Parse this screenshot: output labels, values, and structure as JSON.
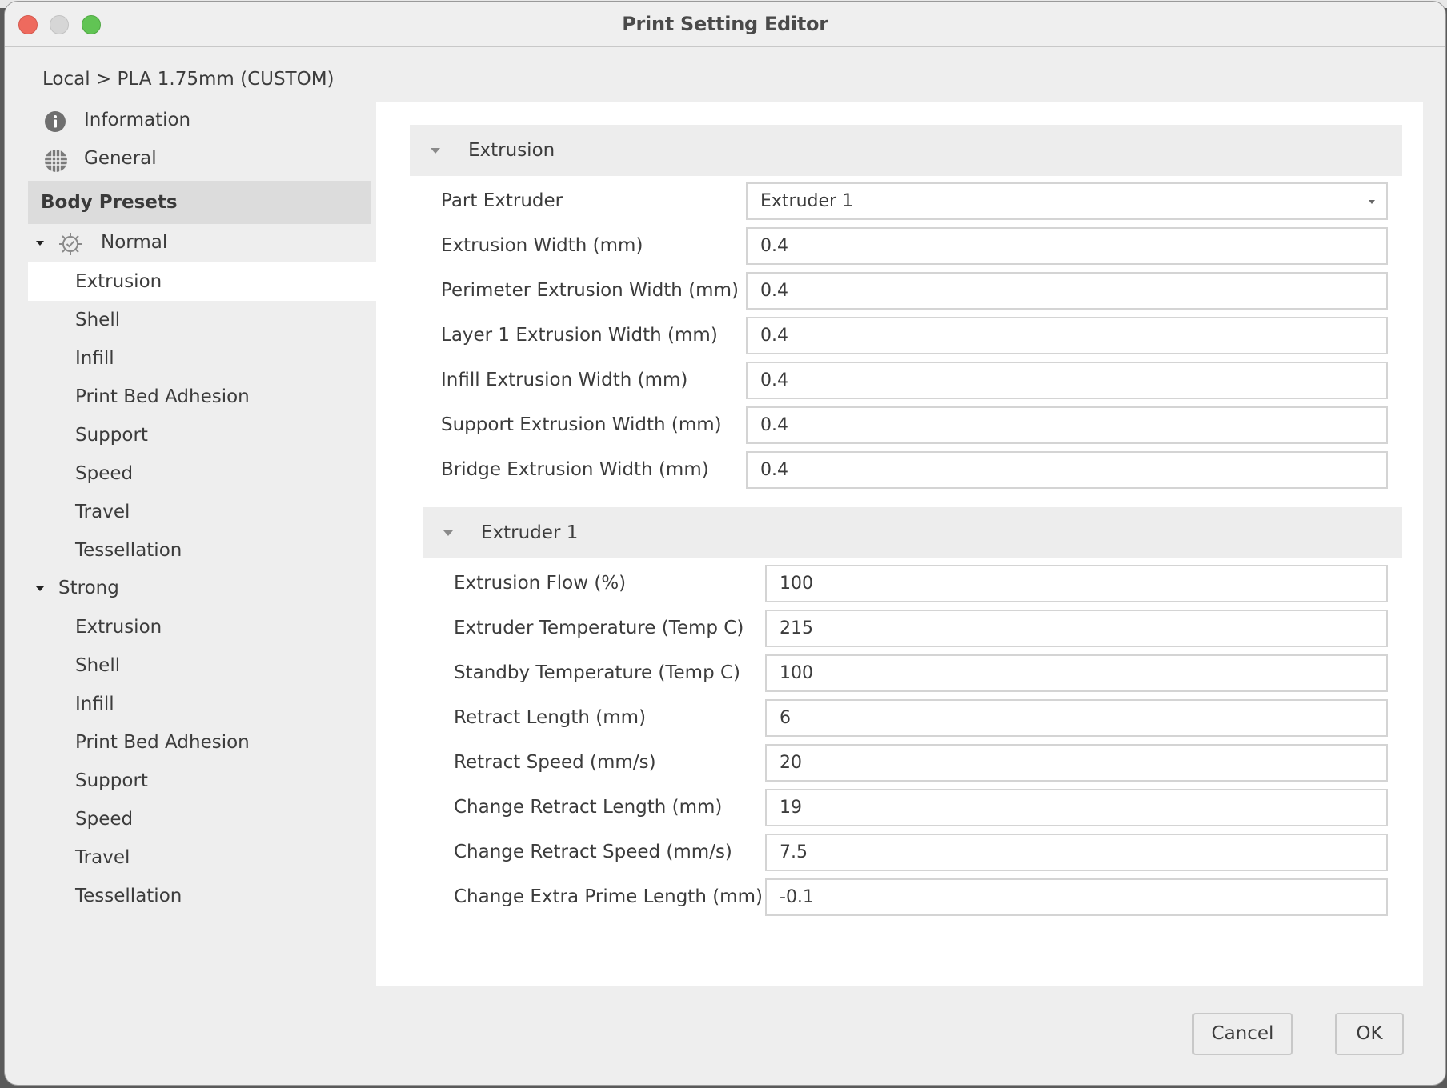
{
  "window": {
    "title": "Print Setting Editor",
    "controls": [
      "close",
      "minimize",
      "zoom"
    ]
  },
  "breadcrumb": "Local > PLA 1.75mm (CUSTOM)",
  "sidebar": {
    "top_items": [
      {
        "label": "Information",
        "icon": "info-icon"
      },
      {
        "label": "General",
        "icon": "globe-icon"
      }
    ],
    "section_header": "Body Presets",
    "groups": [
      {
        "label": "Normal",
        "icon": "gear-check-icon",
        "expanded": true,
        "items": [
          "Extrusion",
          "Shell",
          "Infill",
          "Print Bed Adhesion",
          "Support",
          "Speed",
          "Travel",
          "Tessellation"
        ],
        "active_index": 0
      },
      {
        "label": "Strong",
        "expanded": true,
        "items": [
          "Extrusion",
          "Shell",
          "Infill",
          "Print Bed Adhesion",
          "Support",
          "Speed",
          "Travel",
          "Tessellation"
        ]
      }
    ]
  },
  "main": {
    "extrusion_section": {
      "title": "Extrusion",
      "fields": [
        {
          "label": "Part Extruder",
          "value": "Extruder 1",
          "type": "select"
        },
        {
          "label": "Extrusion Width (mm)",
          "value": "0.4"
        },
        {
          "label": "Perimeter Extrusion Width (mm)",
          "value": "0.4"
        },
        {
          "label": "Layer 1 Extrusion Width (mm)",
          "value": "0.4"
        },
        {
          "label": "Infill Extrusion Width (mm)",
          "value": "0.4"
        },
        {
          "label": "Support Extrusion Width (mm)",
          "value": "0.4"
        },
        {
          "label": "Bridge Extrusion Width (mm)",
          "value": "0.4"
        }
      ]
    },
    "extruder_section": {
      "title": "Extruder 1",
      "fields": [
        {
          "label": "Extrusion Flow (%)",
          "value": "100"
        },
        {
          "label": "Extruder Temperature (Temp C)",
          "value": "215"
        },
        {
          "label": "Standby Temperature (Temp C)",
          "value": "100"
        },
        {
          "label": "Retract Length (mm)",
          "value": "6"
        },
        {
          "label": "Retract Speed (mm/s)",
          "value": "20"
        },
        {
          "label": "Change Retract Length (mm)",
          "value": "19"
        },
        {
          "label": "Change Retract Speed (mm/s)",
          "value": "7.5"
        },
        {
          "label": "Change Extra Prime Length (mm)",
          "value": "-0.1"
        }
      ]
    }
  },
  "footer": {
    "cancel_label": "Cancel",
    "ok_label": "OK"
  }
}
